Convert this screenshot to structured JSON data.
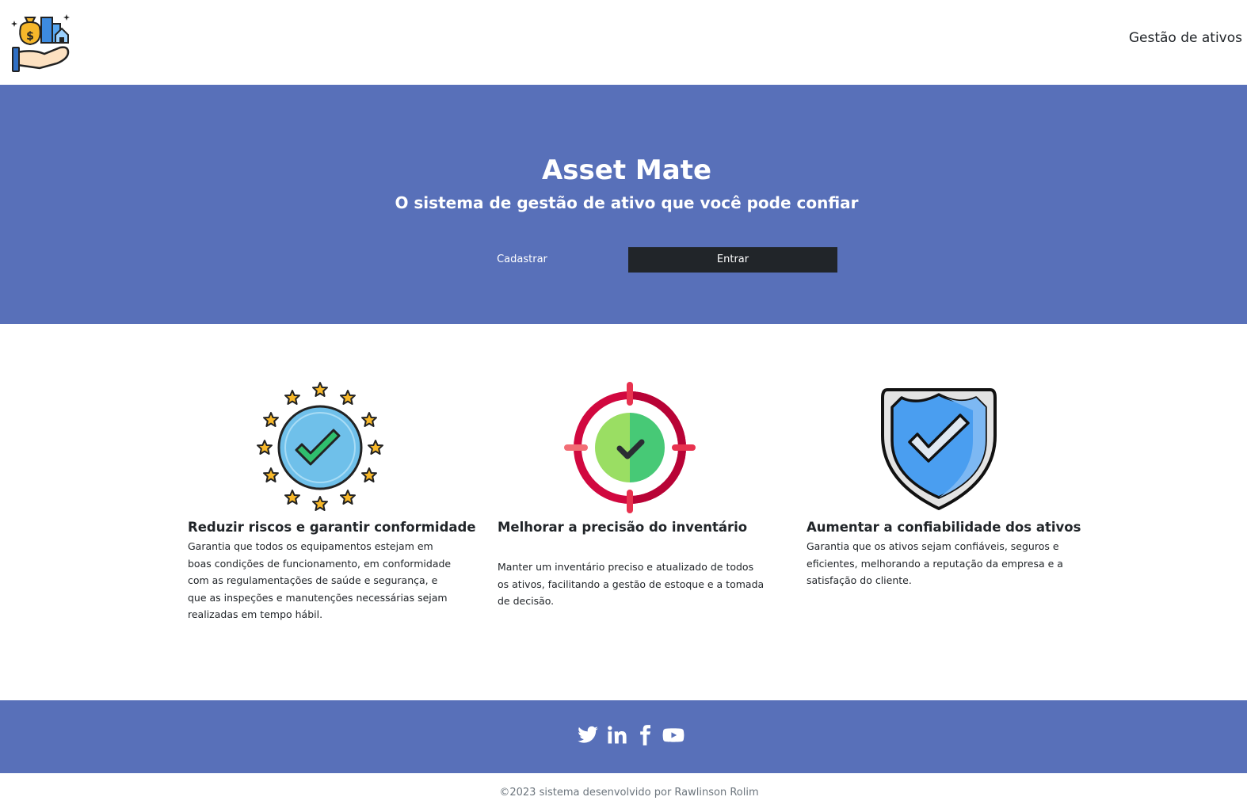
{
  "header": {
    "nav_link": "Gestão de ativos"
  },
  "hero": {
    "title": "Asset Mate",
    "subtitle": "O sistema de gestão de ativo que você pode confiar",
    "register_label": "Cadastrar",
    "login_label": "Entrar"
  },
  "features": [
    {
      "icon": "stars-check-icon",
      "title": "Reduzir riscos e garantir conformidade",
      "text": "Garantia que todos os equipamentos estejam em boas condições de funcionamento, em conformidade com as regulamentações de saúde e segurança, e que as inspeções e manutenções necessárias sejam realizadas em tempo hábil."
    },
    {
      "icon": "target-check-icon",
      "title": "Melhorar a precisão do inventário",
      "text": "Manter um inventário preciso e atualizado de todos os ativos, facilitando a gestão de estoque e a tomada de decisão."
    },
    {
      "icon": "shield-check-icon",
      "title": "Aumentar a confiabilidade dos ativos",
      "text": "Garantia que os ativos sejam confiáveis, seguros e eficientes, melhorando a reputação da empresa e a satisfação do cliente."
    }
  ],
  "footer": {
    "social": [
      "twitter-icon",
      "linkedin-icon",
      "facebook-icon",
      "youtube-icon"
    ],
    "copyright": "©2023 sistema desenvolvido por Rawlinson Rolim"
  },
  "colors": {
    "brand": "#5870b9",
    "dark": "#212529"
  }
}
